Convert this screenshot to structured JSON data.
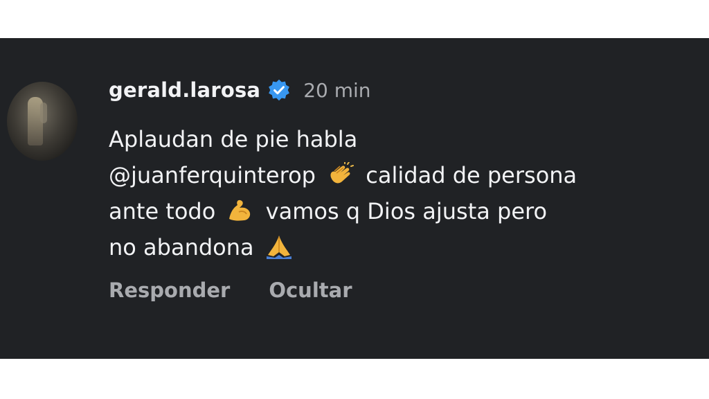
{
  "comment": {
    "username": "gerald.larosa",
    "time": "20 min",
    "verified_icon": "verified-badge-icon",
    "accent_color": "#3897f0",
    "lines": {
      "l1": "Aplaudan de pie habla",
      "l2_mention": "@juanferquinterop",
      "l2_text": "calidad de persona",
      "l3_a": "ante todo",
      "l3_b": "vamos q Dios ajusta pero",
      "l4": "no abandona"
    },
    "emojis": {
      "clap": "clapping-hands-emoji",
      "muscle": "flexed-biceps-emoji",
      "pray": "folded-hands-emoji"
    }
  },
  "actions": {
    "reply_label": "Responder",
    "hide_label": "Ocultar"
  }
}
